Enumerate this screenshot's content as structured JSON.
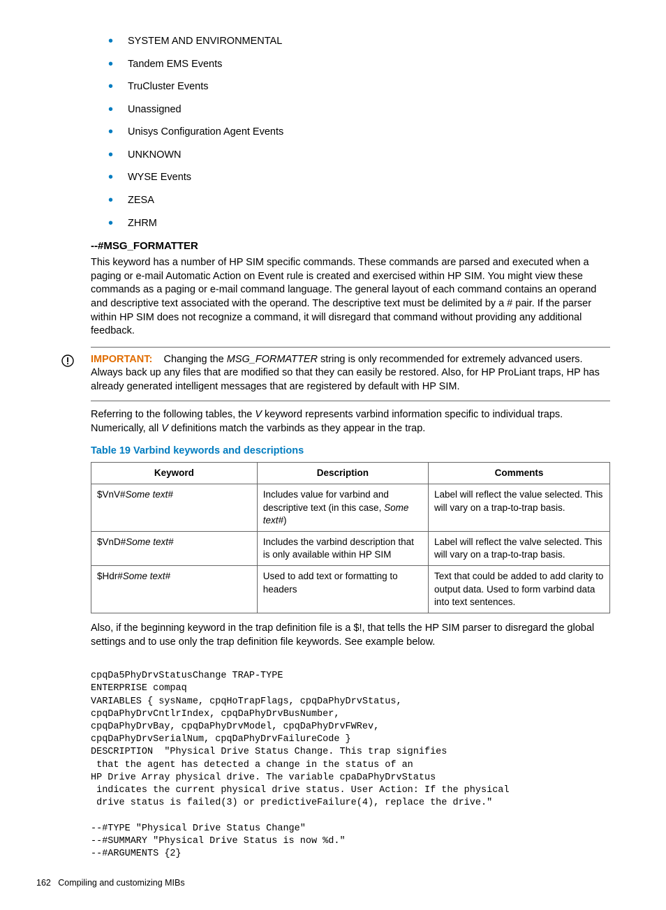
{
  "bullets": {
    "0": "SYSTEM AND ENVIRONMENTAL",
    "1": "Tandem EMS Events",
    "2": "TruCluster Events",
    "3": "Unassigned",
    "4": "Unisys Configuration Agent Events",
    "5": "UNKNOWN",
    "6": "WYSE Events",
    "7": "ZESA",
    "8": "ZHRM"
  },
  "heading": "--#MSG_FORMATTER",
  "intro": "This keyword has a number of HP SIM specific commands. These commands are parsed and executed when a paging or e-mail Automatic Action on Event rule is created and exercised within HP SIM. You might view these commands as a paging or e-mail command language. The general layout of each command contains an operand and descriptive text associated with the operand. The descriptive text must be delimited by a # pair. If the parser within HP SIM does not recognize a command, it will disregard that command without providing any additional feedback.",
  "important": {
    "label": "IMPORTANT:",
    "pre": "Changing the ",
    "term": "MSG_FORMATTER",
    "post": " string is only recommended for extremely advanced users. Always back up any files that are modified so that they can easily be restored. Also, for HP ProLiant traps, HP has already generated intelligent messages that are registered by default with HP SIM."
  },
  "referring": {
    "p1a": "Referring to the following tables, the ",
    "p1b": " keyword represents varbind information specific to individual traps. Numerically, all ",
    "p1c": " definitions match the varbinds as they appear in the trap.",
    "v": "V"
  },
  "tablecap": "Table 19 Varbind keywords and descriptions",
  "th": {
    "0": "Keyword",
    "1": "Description",
    "2": "Comments"
  },
  "rows": {
    "0": {
      "kwpre": "$VnV#",
      "kwital": "Some text#",
      "desc_a": "Includes value for varbind and descriptive text (in this case, ",
      "desc_i": "Some text#",
      "desc_b": ")",
      "comm": "Label will reflect the value selected. This will vary on a trap-to-trap basis."
    },
    "1": {
      "kwpre": "$VnD#",
      "kwital": "Some text#",
      "desc": "Includes the varbind description that is only available within HP SIM",
      "comm": "Label will reflect the valve selected. This will vary on a trap-to-trap basis."
    },
    "2": {
      "kwpre": "$Hdr#",
      "kwital": "Some text#",
      "desc": "Used to add text or formatting to headers",
      "comm": "Text that could be added to add clarity to output data. Used to form varbind data into text sentences."
    }
  },
  "after_table": "Also, if the beginning keyword in the trap definition file is a $!, that tells the HP SIM parser to disregard the global settings and to use only the trap definition file keywords. See example below.",
  "code": "cpqDa5PhyDrvStatusChange TRAP-TYPE\nENTERPRISE compaq\nVARIABLES { sysName, cpqHoTrapFlags, cpqDaPhyDrvStatus,\ncpqDaPhyDrvCntlrIndex, cpqDaPhyDrvBusNumber,\ncpqDaPhyDrvBay, cpqDaPhyDrvModel, cpqDaPhyDrvFWRev,\ncpqDaPhyDrvSerialNum, cpqDaPhyDrvFailureCode }\nDESCRIPTION  \"Physical Drive Status Change. This trap signifies\n that the agent has detected a change in the status of an\nHP Drive Array physical drive. The variable cpaDaPhyDrvStatus\n indicates the current physical drive status. User Action: If the physical\n drive status is failed(3) or predictiveFailure(4), replace the drive.\"\n\n--#TYPE \"Physical Drive Status Change\"\n--#SUMMARY \"Physical Drive Status is now %d.\"\n--#ARGUMENTS {2}",
  "footer": {
    "page": "162",
    "title": "Compiling and customizing MIBs"
  }
}
